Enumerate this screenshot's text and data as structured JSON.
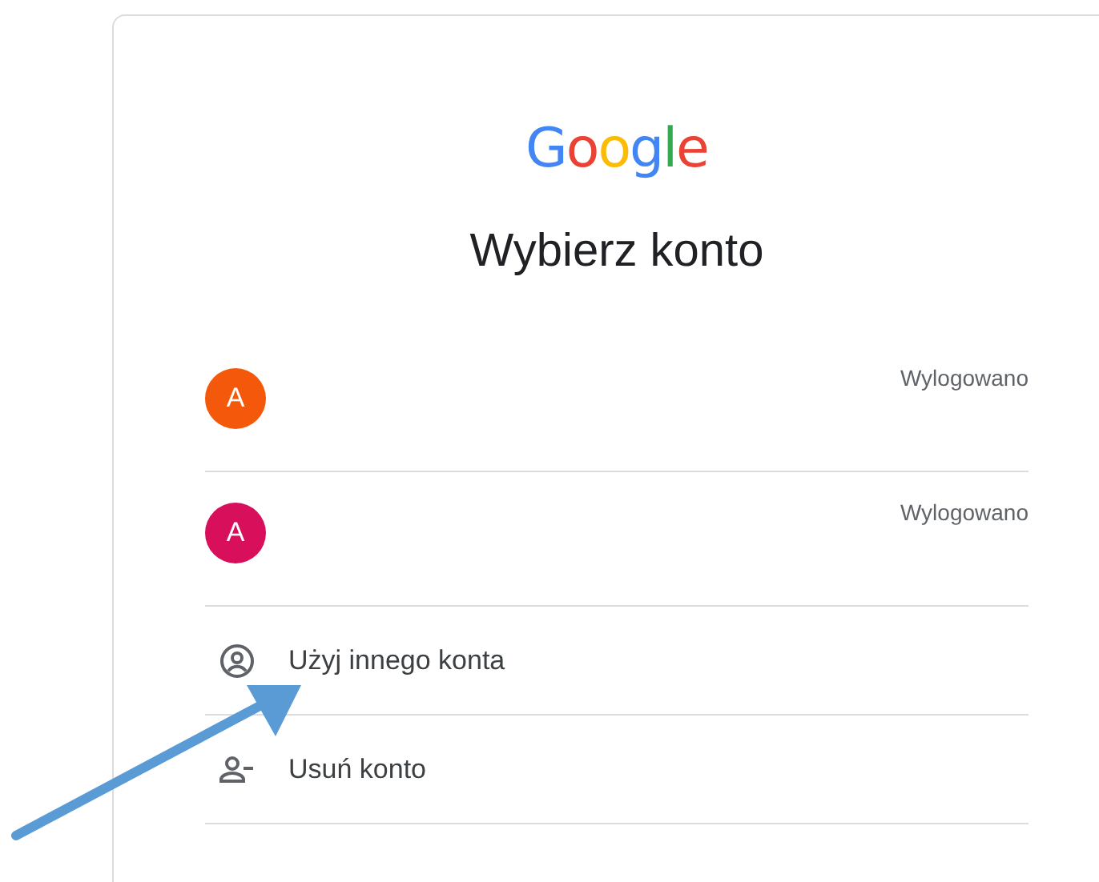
{
  "logo": {
    "text": "Google"
  },
  "title": "Wybierz konto",
  "accounts": [
    {
      "initial": "A",
      "color": "#f4590b",
      "status": "Wylogowano"
    },
    {
      "initial": "A",
      "color": "#d80f5a",
      "status": "Wylogowano"
    }
  ],
  "actions": [
    {
      "kind": "add",
      "label": "Użyj innego konta"
    },
    {
      "kind": "remove",
      "label": "Usuń konto"
    }
  ]
}
